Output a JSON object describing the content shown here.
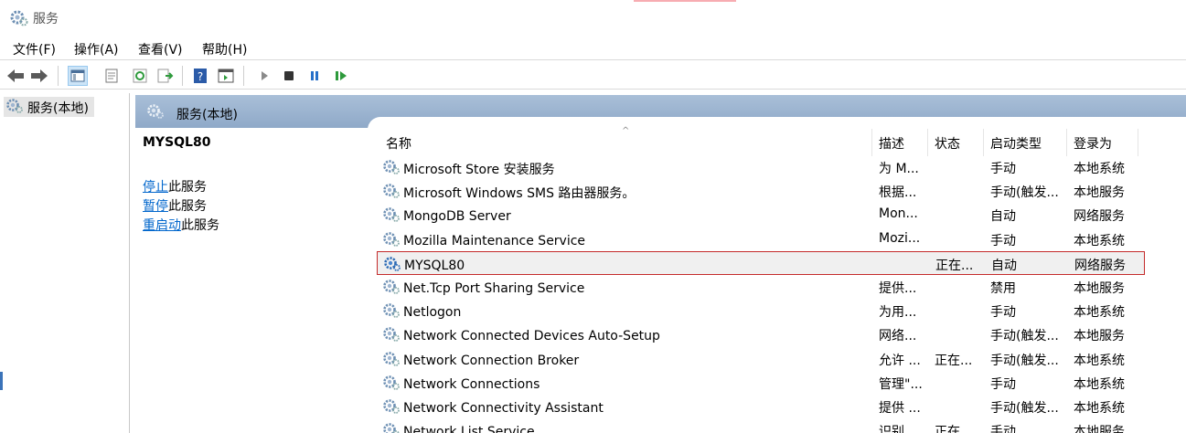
{
  "window": {
    "title": "服务"
  },
  "menu": [
    "文件(F)",
    "操作(A)",
    "查看(V)",
    "帮助(H)"
  ],
  "tree": {
    "node_label": "服务(本地)"
  },
  "panel": {
    "header_label": "服务(本地)"
  },
  "detail": {
    "service_name": "MYSQL80",
    "actions": [
      {
        "link": "停止",
        "suffix": "此服务"
      },
      {
        "link": "暂停",
        "suffix": "此服务"
      },
      {
        "link": "重启动",
        "suffix": "此服务"
      }
    ]
  },
  "columns": [
    "名称",
    "描述",
    "状态",
    "启动类型",
    "登录为"
  ],
  "rows": [
    {
      "name": "Microsoft Store 安装服务",
      "desc": "为 M...",
      "status": "",
      "startup": "手动",
      "logon": "本地系统"
    },
    {
      "name": "Microsoft Windows SMS 路由器服务。",
      "desc": "根据...",
      "status": "",
      "startup": "手动(触发...",
      "logon": "本地服务"
    },
    {
      "name": "MongoDB Server",
      "desc": "Mon...",
      "status": "",
      "startup": "自动",
      "logon": "网络服务"
    },
    {
      "name": "Mozilla Maintenance Service",
      "desc": "Mozi...",
      "status": "",
      "startup": "手动",
      "logon": "本地系统"
    },
    {
      "name": "MYSQL80",
      "desc": "",
      "status": "正在...",
      "startup": "自动",
      "logon": "网络服务",
      "selected": true
    },
    {
      "name": "Net.Tcp Port Sharing Service",
      "desc": "提供...",
      "status": "",
      "startup": "禁用",
      "logon": "本地服务"
    },
    {
      "name": "Netlogon",
      "desc": "为用...",
      "status": "",
      "startup": "手动",
      "logon": "本地系统"
    },
    {
      "name": "Network Connected Devices Auto-Setup",
      "desc": "网络...",
      "status": "",
      "startup": "手动(触发...",
      "logon": "本地服务"
    },
    {
      "name": "Network Connection Broker",
      "desc": "允许 ...",
      "status": "正在...",
      "startup": "手动(触发...",
      "logon": "本地系统"
    },
    {
      "name": "Network Connections",
      "desc": "管理\"...",
      "status": "",
      "startup": "手动",
      "logon": "本地系统"
    },
    {
      "name": "Network Connectivity Assistant",
      "desc": "提供 ...",
      "status": "",
      "startup": "手动(触发...",
      "logon": "本地系统"
    },
    {
      "name": "Network List Service",
      "desc": "识别...",
      "status": "正在...",
      "startup": "手动",
      "logon": "本地服务"
    }
  ],
  "icons": {
    "app": "gear-icon",
    "toolbar": [
      "back-arrow-icon",
      "forward-arrow-icon",
      "console-tree-icon",
      "properties-icon",
      "refresh-icon",
      "export-list-icon",
      "help-icon",
      "view-icon",
      "play-icon",
      "stop-icon",
      "pause-icon",
      "restart-icon"
    ]
  },
  "colors": {
    "selection_border": "#c42b2b",
    "link": "#0066cc",
    "header_band": "#9fb6d1"
  }
}
